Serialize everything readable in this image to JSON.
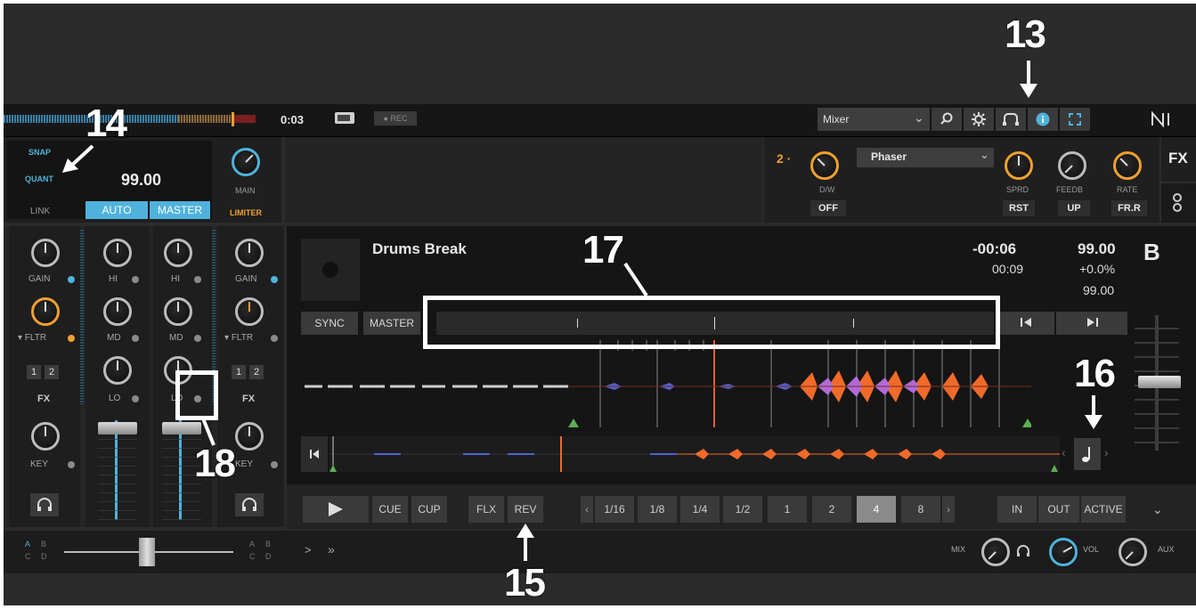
{
  "topbar": {
    "time": "0:03",
    "rec_label": "● REC",
    "layout_select": "Mixer",
    "chevron": "⌄"
  },
  "mixer_header": {
    "snap": "SNAP",
    "quant": "QUANT",
    "tempo": "99.00",
    "link": "LINK",
    "auto": "AUTO",
    "master": "MASTER",
    "main": "MAIN",
    "limiter": "LIMITER"
  },
  "fx_unit": {
    "number": "2 ·",
    "effect": "Phaser",
    "dw": "D/W",
    "off": "OFF",
    "sprd": "SPRD",
    "rst": "RST",
    "feedb": "FEEDB",
    "up": "UP",
    "rate": "RATE",
    "frr": "FR.R",
    "fx_tab": "FX"
  },
  "channel_strip": {
    "gain": "GAIN",
    "hi": "HI",
    "md": "MD",
    "lo": "LO",
    "fltr": "FLTR",
    "fx": "FX",
    "key": "KEY",
    "fx1": "1",
    "fx2": "2"
  },
  "deck": {
    "title": "Drums Break",
    "remaining": "-00:06",
    "elapsed": "00:09",
    "bpm": "99.00",
    "pitch": "+0.0%",
    "base_bpm": "99.00",
    "letter": "B",
    "sync": "SYNC",
    "master": "MASTER"
  },
  "transport": {
    "cue": "CUE",
    "cup": "CUP",
    "flx": "FLX",
    "rev": "REV",
    "loop_sizes": [
      "1/16",
      "1/8",
      "1/4",
      "1/2",
      "1",
      "2",
      "4",
      "8"
    ],
    "active_loop": "4",
    "in": "IN",
    "out": "OUT",
    "active": "ACTIVE",
    "prev": "‹",
    "next": "›",
    "more": "⌄"
  },
  "footer": {
    "a": "A",
    "b": "B",
    "c": "C",
    "d": "D",
    "arrow1": ">",
    "arrow2": "»",
    "mix": "MIX",
    "vol": "VOL",
    "aux": "AUX"
  },
  "annotations": {
    "n13": "13",
    "n14": "14",
    "n15": "15",
    "n16": "16",
    "n17": "17",
    "n18": "18"
  },
  "colors": {
    "accent_blue": "#4fb2dc",
    "accent_orange": "#f0a030",
    "waveform_orange": "#f06a2a",
    "waveform_purple": "#b06ad8",
    "waveform_blue": "#5060d0"
  }
}
